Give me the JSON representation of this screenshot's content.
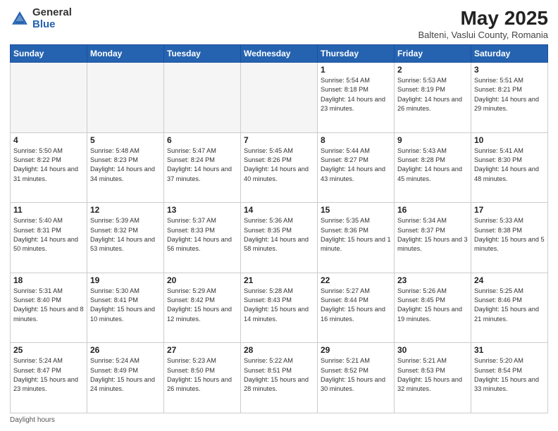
{
  "header": {
    "logo_general": "General",
    "logo_blue": "Blue",
    "main_title": "May 2025",
    "subtitle": "Balteni, Vaslui County, Romania"
  },
  "footer": {
    "note": "Daylight hours"
  },
  "days_of_week": [
    "Sunday",
    "Monday",
    "Tuesday",
    "Wednesday",
    "Thursday",
    "Friday",
    "Saturday"
  ],
  "weeks": [
    [
      {
        "day": "",
        "info": ""
      },
      {
        "day": "",
        "info": ""
      },
      {
        "day": "",
        "info": ""
      },
      {
        "day": "",
        "info": ""
      },
      {
        "day": "1",
        "info": "Sunrise: 5:54 AM\nSunset: 8:18 PM\nDaylight: 14 hours\nand 23 minutes."
      },
      {
        "day": "2",
        "info": "Sunrise: 5:53 AM\nSunset: 8:19 PM\nDaylight: 14 hours\nand 26 minutes."
      },
      {
        "day": "3",
        "info": "Sunrise: 5:51 AM\nSunset: 8:21 PM\nDaylight: 14 hours\nand 29 minutes."
      }
    ],
    [
      {
        "day": "4",
        "info": "Sunrise: 5:50 AM\nSunset: 8:22 PM\nDaylight: 14 hours\nand 31 minutes."
      },
      {
        "day": "5",
        "info": "Sunrise: 5:48 AM\nSunset: 8:23 PM\nDaylight: 14 hours\nand 34 minutes."
      },
      {
        "day": "6",
        "info": "Sunrise: 5:47 AM\nSunset: 8:24 PM\nDaylight: 14 hours\nand 37 minutes."
      },
      {
        "day": "7",
        "info": "Sunrise: 5:45 AM\nSunset: 8:26 PM\nDaylight: 14 hours\nand 40 minutes."
      },
      {
        "day": "8",
        "info": "Sunrise: 5:44 AM\nSunset: 8:27 PM\nDaylight: 14 hours\nand 43 minutes."
      },
      {
        "day": "9",
        "info": "Sunrise: 5:43 AM\nSunset: 8:28 PM\nDaylight: 14 hours\nand 45 minutes."
      },
      {
        "day": "10",
        "info": "Sunrise: 5:41 AM\nSunset: 8:30 PM\nDaylight: 14 hours\nand 48 minutes."
      }
    ],
    [
      {
        "day": "11",
        "info": "Sunrise: 5:40 AM\nSunset: 8:31 PM\nDaylight: 14 hours\nand 50 minutes."
      },
      {
        "day": "12",
        "info": "Sunrise: 5:39 AM\nSunset: 8:32 PM\nDaylight: 14 hours\nand 53 minutes."
      },
      {
        "day": "13",
        "info": "Sunrise: 5:37 AM\nSunset: 8:33 PM\nDaylight: 14 hours\nand 56 minutes."
      },
      {
        "day": "14",
        "info": "Sunrise: 5:36 AM\nSunset: 8:35 PM\nDaylight: 14 hours\nand 58 minutes."
      },
      {
        "day": "15",
        "info": "Sunrise: 5:35 AM\nSunset: 8:36 PM\nDaylight: 15 hours\nand 1 minute."
      },
      {
        "day": "16",
        "info": "Sunrise: 5:34 AM\nSunset: 8:37 PM\nDaylight: 15 hours\nand 3 minutes."
      },
      {
        "day": "17",
        "info": "Sunrise: 5:33 AM\nSunset: 8:38 PM\nDaylight: 15 hours\nand 5 minutes."
      }
    ],
    [
      {
        "day": "18",
        "info": "Sunrise: 5:31 AM\nSunset: 8:40 PM\nDaylight: 15 hours\nand 8 minutes."
      },
      {
        "day": "19",
        "info": "Sunrise: 5:30 AM\nSunset: 8:41 PM\nDaylight: 15 hours\nand 10 minutes."
      },
      {
        "day": "20",
        "info": "Sunrise: 5:29 AM\nSunset: 8:42 PM\nDaylight: 15 hours\nand 12 minutes."
      },
      {
        "day": "21",
        "info": "Sunrise: 5:28 AM\nSunset: 8:43 PM\nDaylight: 15 hours\nand 14 minutes."
      },
      {
        "day": "22",
        "info": "Sunrise: 5:27 AM\nSunset: 8:44 PM\nDaylight: 15 hours\nand 16 minutes."
      },
      {
        "day": "23",
        "info": "Sunrise: 5:26 AM\nSunset: 8:45 PM\nDaylight: 15 hours\nand 19 minutes."
      },
      {
        "day": "24",
        "info": "Sunrise: 5:25 AM\nSunset: 8:46 PM\nDaylight: 15 hours\nand 21 minutes."
      }
    ],
    [
      {
        "day": "25",
        "info": "Sunrise: 5:24 AM\nSunset: 8:47 PM\nDaylight: 15 hours\nand 23 minutes."
      },
      {
        "day": "26",
        "info": "Sunrise: 5:24 AM\nSunset: 8:49 PM\nDaylight: 15 hours\nand 24 minutes."
      },
      {
        "day": "27",
        "info": "Sunrise: 5:23 AM\nSunset: 8:50 PM\nDaylight: 15 hours\nand 26 minutes."
      },
      {
        "day": "28",
        "info": "Sunrise: 5:22 AM\nSunset: 8:51 PM\nDaylight: 15 hours\nand 28 minutes."
      },
      {
        "day": "29",
        "info": "Sunrise: 5:21 AM\nSunset: 8:52 PM\nDaylight: 15 hours\nand 30 minutes."
      },
      {
        "day": "30",
        "info": "Sunrise: 5:21 AM\nSunset: 8:53 PM\nDaylight: 15 hours\nand 32 minutes."
      },
      {
        "day": "31",
        "info": "Sunrise: 5:20 AM\nSunset: 8:54 PM\nDaylight: 15 hours\nand 33 minutes."
      }
    ]
  ]
}
